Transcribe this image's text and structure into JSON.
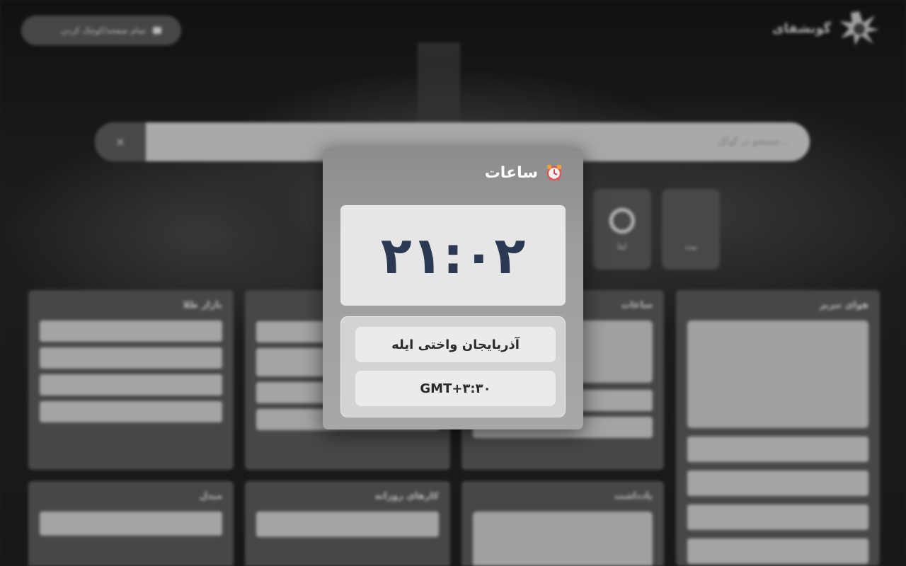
{
  "background": {
    "brand": "گونشفای",
    "top_button_label": "تمام صفحه/کوچک کردن",
    "search_placeholder": "جستجو در گوگل...",
    "search_clear": "×",
    "tiles": [
      "بیت",
      "ایتا"
    ],
    "cards": {
      "weather_title": "هوای تبریز",
      "clock_title": "ساعات",
      "currency_title": "بازار طلا",
      "notes_title": "یادداشت",
      "todo_title": "کارهای روزانه",
      "converter_title": "مبدل"
    }
  },
  "modal": {
    "title": "ساعات",
    "icon": "alarm-clock-icon",
    "time": "۲۱:۰۲",
    "timezone_name": "آذربایجان واختی ایله",
    "gmt_offset": "GMT+۳:۳۰"
  },
  "colors": {
    "time_text": "#2b3a52",
    "modal_title": "#ffffff"
  }
}
